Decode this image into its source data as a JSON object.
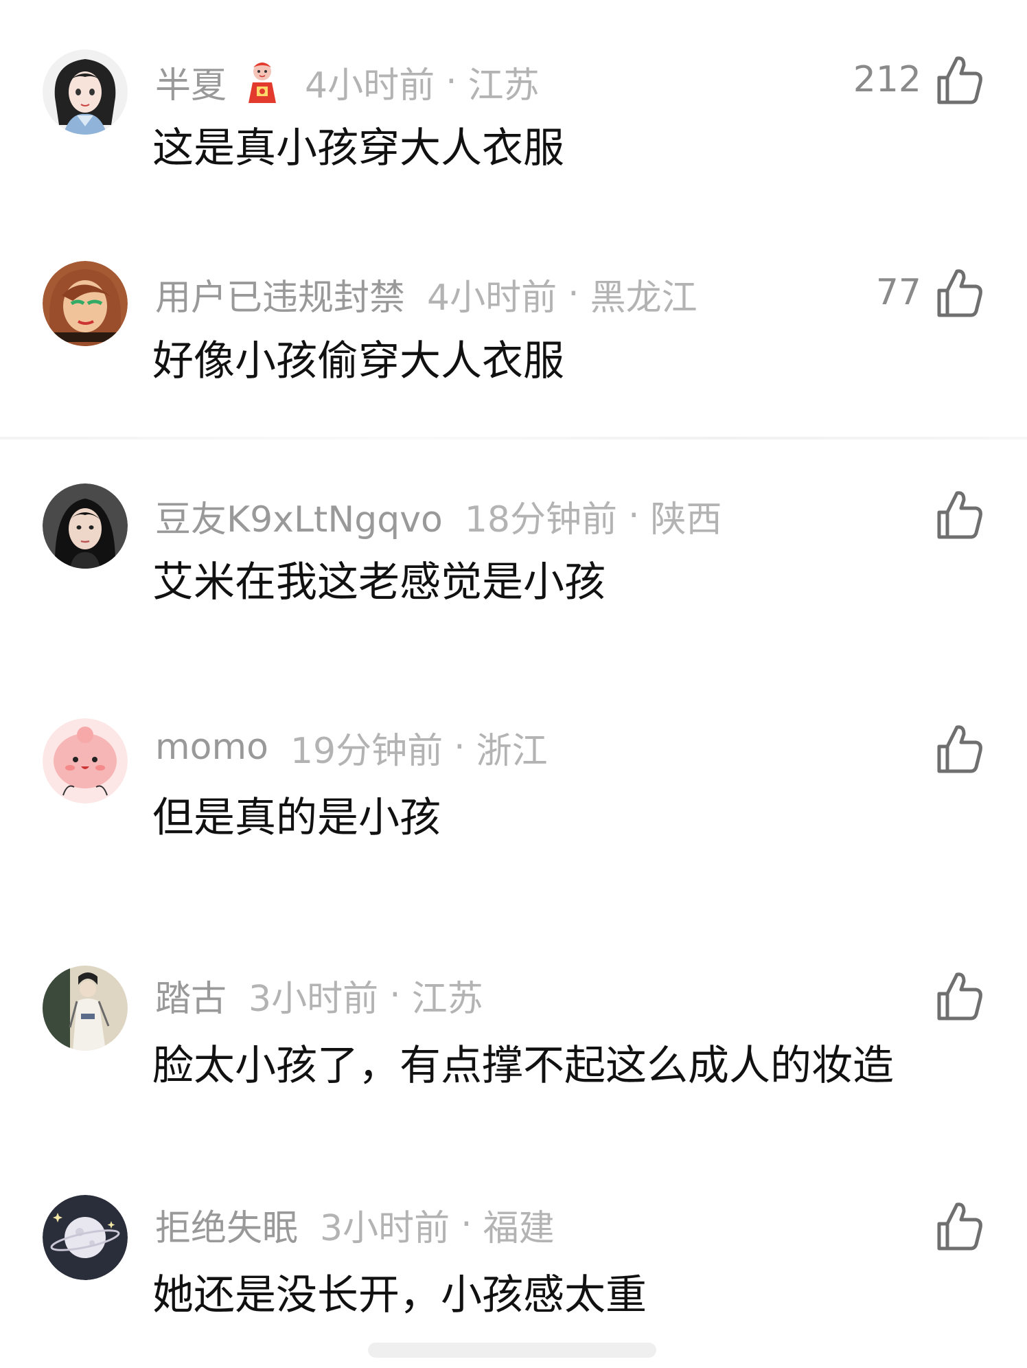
{
  "comments": [
    {
      "username": "半夏",
      "has_badge": true,
      "time": "4小时前",
      "separator": "·",
      "region": "江苏",
      "text": "这是真小孩穿大人衣服",
      "likes": "212",
      "avatar_icon": "anime-girl-avatar-icon"
    },
    {
      "username": "用户已违规封禁",
      "has_badge": false,
      "time": "4小时前",
      "separator": "·",
      "region": "黑龙江",
      "text": "好像小孩偷穿大人衣服",
      "likes": "77",
      "avatar_icon": "cartoon-woman-avatar-icon"
    },
    {
      "username": "豆友K9xLtNgqvo",
      "has_badge": false,
      "time": "18分钟前",
      "separator": "·",
      "region": "陕西",
      "text": "艾米在我这老感觉是小孩",
      "likes": "",
      "avatar_icon": "portrait-photo-avatar-icon"
    },
    {
      "username": "momo",
      "has_badge": false,
      "time": "19分钟前",
      "separator": "·",
      "region": "浙江",
      "text": "但是真的是小孩",
      "likes": "",
      "avatar_icon": "pink-blob-avatar-icon"
    },
    {
      "username": "踏古",
      "has_badge": false,
      "time": "3小时前",
      "separator": "·",
      "region": "江苏",
      "text": "脸太小孩了，有点撑不起这么成人的妆造",
      "likes": "",
      "avatar_icon": "hanfu-figure-avatar-icon"
    },
    {
      "username": "拒绝失眠",
      "has_badge": false,
      "time": "3小时前",
      "separator": "·",
      "region": "福建",
      "text": "她还是没长开，小孩感太重",
      "likes": "",
      "avatar_icon": "moon-planet-avatar-icon"
    }
  ],
  "colors": {
    "username": "#999999",
    "meta": "#b3b3b3",
    "text": "#111111",
    "like": "#8a8a8a"
  }
}
